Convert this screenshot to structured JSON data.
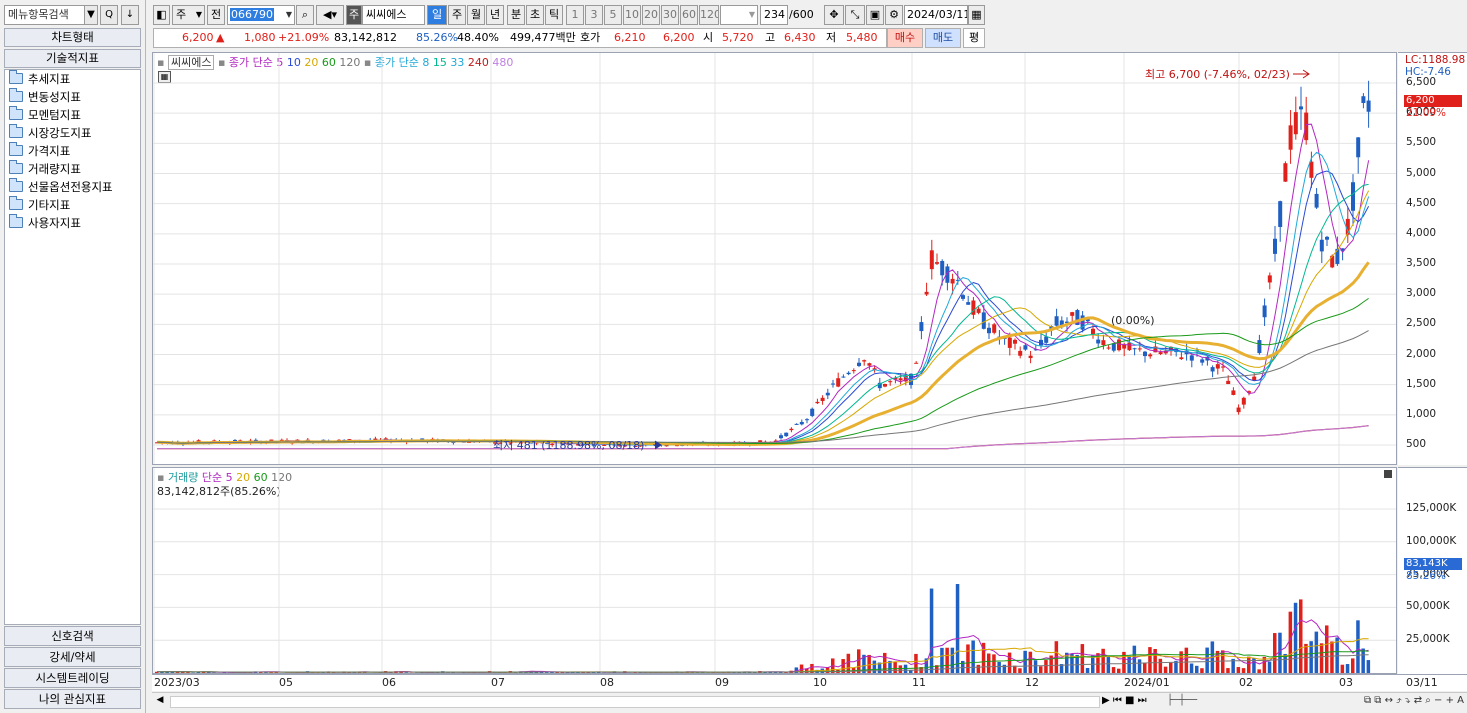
{
  "left_panel": {
    "search_placeholder": "메뉴항목검색",
    "search_icon_label": "Q",
    "download_icon_label": "↓",
    "chart_type_label": "차트형태",
    "tech_indicator_label": "기술적지표",
    "tree_items": [
      "추세지표",
      "변동성지표",
      "모멘텀지표",
      "시장강도지표",
      "가격지표",
      "거래량지표",
      "선물옵션전용지표",
      "기타지표",
      "사용자지표"
    ],
    "bottom_buttons": [
      "신호검색",
      "강세/약세",
      "시스템트레이딩",
      "나의 관심지표"
    ]
  },
  "toolbar": {
    "period_type": "주",
    "prev_label": "전",
    "code": "066790",
    "market_badge": "주",
    "stock_name": "씨씨에스",
    "periods": [
      "일",
      "주",
      "월",
      "년",
      "분",
      "초",
      "틱"
    ],
    "selected_period": "일",
    "intervals": [
      "1",
      "3",
      "5",
      "10",
      "20",
      "30",
      "60",
      "120"
    ],
    "count": "234",
    "count_max": "/600",
    "date": "2024/03/11"
  },
  "ticker": {
    "price": "6,200",
    "up_arrow": "▲",
    "change": "1,080",
    "change_pct": "+21.09%",
    "volume": "83,142,812",
    "volume_ratio": "85.26%",
    "vol_turn": "48.40%",
    "amount": "499,477백만",
    "quote_label": "호가",
    "quote_ask": "6,210",
    "quote_bid": "6,200",
    "open_label": "시",
    "open": "5,720",
    "high_label": "고",
    "high": "6,430",
    "low_label": "저",
    "low": "5,480",
    "buy_label": "매수",
    "sell_label": "매도",
    "eval_label": "평"
  },
  "price_legend": {
    "name": "씨씨에스",
    "ma_a_label": "종가 단순 5",
    "ma_a_periods": [
      "10",
      "20",
      "60",
      "120"
    ],
    "ma_b_label": "종가 단순 8",
    "ma_b_periods": [
      "15",
      "33",
      "240",
      "480"
    ]
  },
  "volume_legend": {
    "label": "거래량",
    "ma_label": "단순 5",
    "ma_periods": [
      "20",
      "60",
      "120"
    ],
    "summary": "83,142,812주(85.26%)"
  },
  "annotations": {
    "high": "최고 6,700 (-7.46%, 02/23)",
    "low": "최저 481 (1188.98%, 08/18)",
    "mid": "(0.00%)"
  },
  "price_axis": {
    "lc": "LC:1188.98",
    "hc": "HC:-7.46",
    "current": "6,200",
    "current_pct": "21.09%",
    "ticks": [
      "6,500",
      "6,000",
      "5,500",
      "5,000",
      "4,500",
      "4,000",
      "3,500",
      "3,000",
      "2,500",
      "2,000",
      "1,500",
      "1,000",
      "500"
    ]
  },
  "volume_axis": {
    "current": "83,143K",
    "current_pct": "85.26%",
    "ticks": [
      "125,000K",
      "100,000K",
      "75,000K",
      "50,000K",
      "25,000K"
    ]
  },
  "x_axis": {
    "labels": [
      "2023/03",
      "05",
      "06",
      "07",
      "08",
      "09",
      "10",
      "11",
      "12",
      "2024/01",
      "02",
      "03"
    ],
    "end_label": "03/11"
  },
  "colors": {
    "up": "#e0201a",
    "down": "#1f5fc2",
    "selected": "#2e7de0",
    "ma5": "#b227c2",
    "ma10": "#2a4bd4",
    "ma20": "#d7a800",
    "ma60": "#1a9a1a",
    "ma120": "#777777",
    "ma8": "#20a8d8",
    "ma15": "#00b890",
    "ma33": "#e8b030",
    "ma240": "#c21a1a",
    "ma480": "#c080e0"
  },
  "chart_data": {
    "type": "line",
    "title": "",
    "xlabel": "",
    "ylabel": "",
    "ylim": [
      0,
      7000
    ],
    "x": [
      "2023/03",
      "05",
      "06",
      "07",
      "08",
      "09",
      "10",
      "11",
      "12",
      "2024/01",
      "02",
      "03"
    ],
    "series": [
      {
        "name": "종가",
        "values": [
          540,
          560,
          580,
          540,
          510,
          520,
          1400,
          3500,
          2400,
          2000,
          2000,
          6200
        ]
      }
    ]
  }
}
